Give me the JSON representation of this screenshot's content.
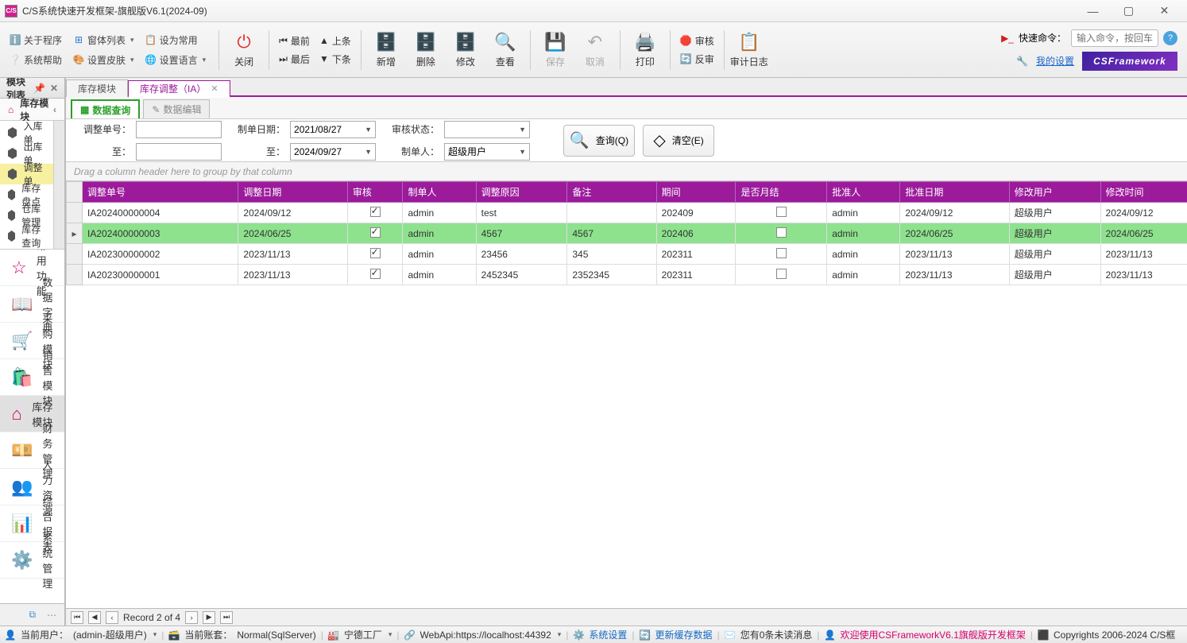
{
  "window": {
    "title": "C/S系统快速开发框架-旗舰版V6.1(2024-09)"
  },
  "menubar": {
    "about": "关于程序",
    "forms": "窗体列表",
    "setcommon": "设为常用",
    "help": "系统帮助",
    "skin": "设置皮肤",
    "lang": "设置语言"
  },
  "toolbar": {
    "close": "关闭",
    "nav": {
      "first": "最前",
      "prev": "上条",
      "last": "最后",
      "next": "下条"
    },
    "add": "新增",
    "del": "删除",
    "edit": "修改",
    "view": "查看",
    "save": "保存",
    "cancel": "取消",
    "print": "打印",
    "approve": "审核",
    "reject": "反审",
    "audit": "审计日志"
  },
  "toolbar_right": {
    "quick_label": "快速命令：",
    "quick_placeholder": "输入命令，按回车",
    "mysettings": "我的设置",
    "brand": "CSFramework"
  },
  "sidebar": {
    "header": "模块列表",
    "panel_title": "库存模块",
    "tree": [
      "入库单",
      "出库单",
      "调整单",
      "库存盘点",
      "仓库管理",
      "库存查询"
    ],
    "active_tree_index": 2,
    "sections": [
      "常用功能",
      "数据字典",
      "采购模块",
      "销售模块",
      "库存模块",
      "财务管理",
      "人力资源",
      "综合报表",
      "系统管理"
    ],
    "active_section_index": 4
  },
  "tabs": {
    "items": [
      {
        "label": "库存模块",
        "closable": false
      },
      {
        "label": "库存调整（IA）",
        "closable": true
      }
    ],
    "active": 1
  },
  "subtabs": {
    "query": "数据查询",
    "edit": "数据编辑",
    "active": 0
  },
  "filters": {
    "labels": {
      "docno": "调整单号：",
      "to": "至：",
      "date": "制单日期：",
      "dateto": "至：",
      "status": "审核状态：",
      "maker": "制单人："
    },
    "values": {
      "docno": "",
      "docno_to": "",
      "date_from": "2021/08/27",
      "date_to": "2024/09/27",
      "status": "",
      "maker": "超级用户"
    },
    "buttons": {
      "query": "查询(Q)",
      "clear": "清空(E)"
    }
  },
  "grid": {
    "group_hint": "Drag a column header here to group by that column",
    "columns": [
      "调整单号",
      "调整日期",
      "审核",
      "制单人",
      "调整原因",
      "备注",
      "期间",
      "是否月结",
      "批准人",
      "批准日期",
      "修改用户",
      "修改时间"
    ],
    "rows": [
      {
        "no": "IA202400000004",
        "date": "2024/09/12",
        "approved": true,
        "maker": "admin",
        "reason": "test",
        "remark": "",
        "period": "202409",
        "closed": false,
        "approver": "admin",
        "appdate": "2024/09/12",
        "moduser": "超级用户",
        "modtime": "2024/09/12"
      },
      {
        "no": "IA202400000003",
        "date": "2024/06/25",
        "approved": true,
        "maker": "admin",
        "reason": "4567",
        "remark": "4567",
        "period": "202406",
        "closed": false,
        "approver": "admin",
        "appdate": "2024/06/25",
        "moduser": "超级用户",
        "modtime": "2024/06/25"
      },
      {
        "no": "IA202300000002",
        "date": "2023/11/13",
        "approved": true,
        "maker": "admin",
        "reason": "23456",
        "remark": "345",
        "period": "202311",
        "closed": false,
        "approver": "admin",
        "appdate": "2023/11/13",
        "moduser": "超级用户",
        "modtime": "2023/11/13"
      },
      {
        "no": "IA202300000001",
        "date": "2023/11/13",
        "approved": true,
        "maker": "admin",
        "reason": "2452345",
        "remark": "2352345",
        "period": "202311",
        "closed": false,
        "approver": "admin",
        "appdate": "2023/11/13",
        "moduser": "超级用户",
        "modtime": "2023/11/13"
      }
    ],
    "selected": 1,
    "pager": "Record 2 of 4"
  },
  "statusbar": {
    "user_label": "当前用户：",
    "user_value": "(admin-超级用户)",
    "acct_label": "当前账套：",
    "acct_value": "Normal(SqlServer)",
    "factory": "宁德工厂",
    "api": "WebApi:https://localhost:44392",
    "syssettings": "系统设置",
    "refresh": "更新缓存数据",
    "msg": "您有0条未读消息",
    "welcome": "欢迎使用CSFrameworkV6.1旗舰版开发框架",
    "copyright": "Copyrights 2006-2024 C/S框"
  }
}
